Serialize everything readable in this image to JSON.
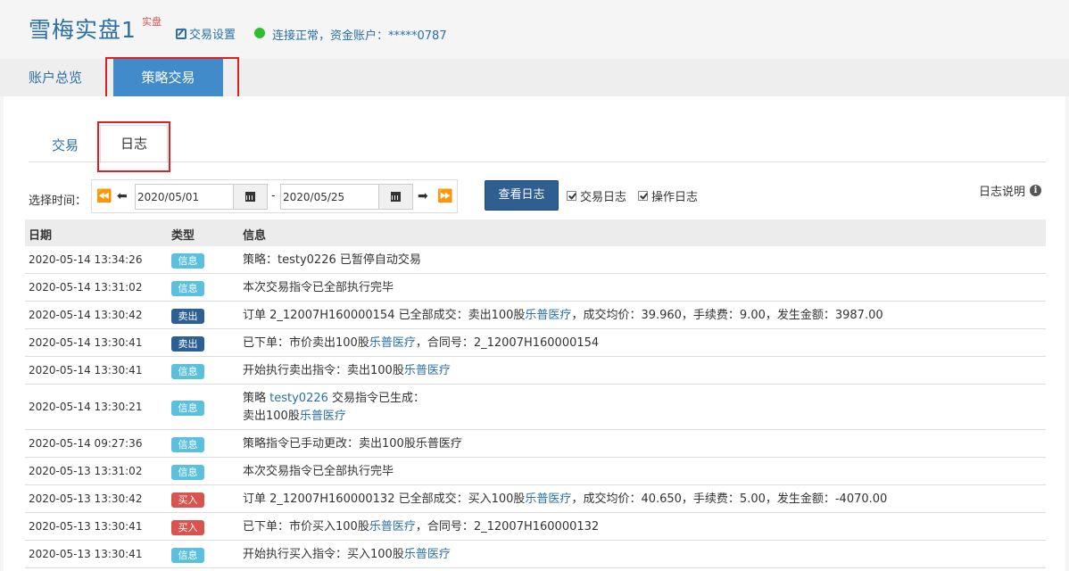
{
  "header": {
    "title": "雪梅实盘1",
    "mode_tag": "实盘",
    "settings_label": "交易设置",
    "status_text": "连接正常，资金账户：*****0787",
    "status_color": "#2ebd2e"
  },
  "main_tabs": {
    "overview": "账户总览",
    "strategy": "策略交易"
  },
  "sub_tabs": {
    "trade": "交易",
    "log": "日志"
  },
  "filter": {
    "time_label": "选择时间：",
    "start_date": "2020/05/01",
    "end_date": "2020/05/25",
    "separator": "-",
    "view_button": "查看日志",
    "trade_log_label": "交易日志",
    "op_log_label": "操作日志",
    "help_label": "日志说明"
  },
  "table": {
    "headers": {
      "date": "日期",
      "type": "类型",
      "info": "信息"
    },
    "rows": [
      {
        "date": "2020-05-14 13:34:26",
        "type": "信息",
        "kind": "info",
        "msg": [
          "策略：testy0226 已暂停自动交易"
        ]
      },
      {
        "date": "2020-05-14 13:31:02",
        "type": "信息",
        "kind": "info",
        "msg": [
          "本次交易指令已全部执行完毕"
        ]
      },
      {
        "date": "2020-05-14 13:30:42",
        "type": "卖出",
        "kind": "sell",
        "msg": [
          "订单 2_12007H160000154 已全部成交：卖出100股",
          "乐普医疗",
          "，成交均价：39.960，手续费：9.00，发生金额：3987.00"
        ]
      },
      {
        "date": "2020-05-14 13:30:41",
        "type": "卖出",
        "kind": "sell",
        "msg": [
          "已下单：市价卖出100股",
          "乐普医疗",
          "，合同号：2_12007H160000154"
        ]
      },
      {
        "date": "2020-05-14 13:30:41",
        "type": "信息",
        "kind": "info",
        "msg": [
          "开始执行卖出指令：卖出100股",
          "乐普医疗"
        ]
      },
      {
        "date": "2020-05-14 13:30:21",
        "type": "信息",
        "kind": "info",
        "msg": [
          "策略 ",
          "testy0226",
          " 交易指令已生成：",
          "卖出100股",
          "乐普医疗"
        ]
      },
      {
        "date": "2020-05-14 09:27:36",
        "type": "信息",
        "kind": "info",
        "msg": [
          "策略指令已手动更改：卖出100股乐普医疗"
        ]
      },
      {
        "date": "2020-05-13 13:31:02",
        "type": "信息",
        "kind": "info",
        "msg": [
          "本次交易指令已全部执行完毕"
        ]
      },
      {
        "date": "2020-05-13 13:30:42",
        "type": "买入",
        "kind": "buy",
        "msg": [
          "订单 2_12007H160000132 已全部成交：买入100股",
          "乐普医疗",
          "，成交均价：40.650，手续费：5.00，发生金额：-4070.00"
        ]
      },
      {
        "date": "2020-05-13 13:30:41",
        "type": "买入",
        "kind": "buy",
        "msg": [
          "已下单：市价买入100股",
          "乐普医疗",
          "，合同号：2_12007H160000132"
        ]
      },
      {
        "date": "2020-05-13 13:30:41",
        "type": "信息",
        "kind": "info",
        "msg": [
          "开始执行买入指令：买入100股",
          "乐普医疗"
        ]
      }
    ]
  }
}
